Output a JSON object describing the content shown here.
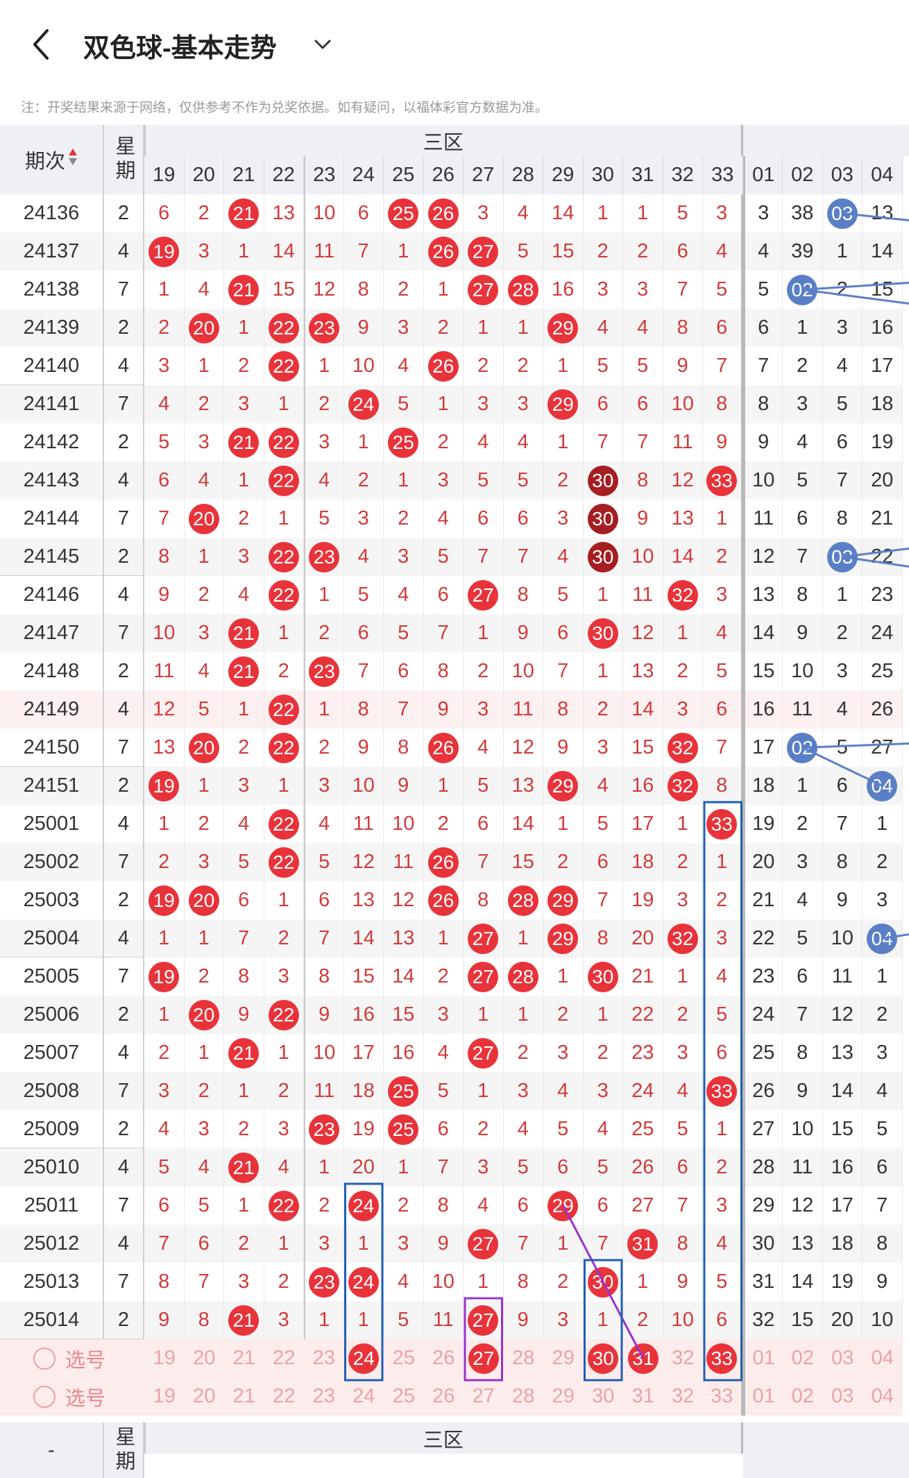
{
  "header": {
    "title": "双色球-基本走势",
    "back_icon": "chevron-left-icon",
    "dropdown_icon": "chevron-down-icon"
  },
  "notice": "注：开奖结果来源于网络，仅供参考不作为兑奖依据。如有疑问，以福体彩官方数据为准。",
  "table": {
    "col_period": "期次",
    "col_weekday": "星期",
    "zone_label": "三区",
    "red_columns": [
      "19",
      "20",
      "21",
      "22",
      "23",
      "24",
      "25",
      "26",
      "27",
      "28",
      "29",
      "30",
      "31",
      "32",
      "33"
    ],
    "blue_columns": [
      "01",
      "02",
      "03",
      "04"
    ],
    "rows": [
      {
        "period": "24136",
        "week": "2",
        "red": [
          "6",
          "2",
          "21",
          "13",
          "10",
          "6",
          "25",
          "26",
          "3",
          "4",
          "14",
          "1",
          "1",
          "5",
          "3"
        ],
        "hit": [
          21,
          25,
          26
        ],
        "blue": [
          "3",
          "38",
          "03",
          "13"
        ],
        "bhit": [
          3
        ]
      },
      {
        "period": "24137",
        "week": "4",
        "red": [
          "19",
          "3",
          "1",
          "14",
          "11",
          "7",
          "1",
          "26",
          "27",
          "5",
          "15",
          "2",
          "2",
          "6",
          "4"
        ],
        "hit": [
          19,
          26,
          27
        ],
        "blue": [
          "4",
          "39",
          "1",
          "14"
        ],
        "bhit": []
      },
      {
        "period": "24138",
        "week": "7",
        "red": [
          "1",
          "4",
          "21",
          "15",
          "12",
          "8",
          "2",
          "1",
          "27",
          "28",
          "16",
          "3",
          "3",
          "7",
          "5"
        ],
        "hit": [
          21,
          27,
          28
        ],
        "blue": [
          "5",
          "02",
          "2",
          "15"
        ],
        "bhit": [
          2
        ]
      },
      {
        "period": "24139",
        "week": "2",
        "red": [
          "2",
          "20",
          "1",
          "22",
          "23",
          "9",
          "3",
          "2",
          "1",
          "1",
          "29",
          "4",
          "4",
          "8",
          "6"
        ],
        "hit": [
          20,
          22,
          23,
          29
        ],
        "blue": [
          "6",
          "1",
          "3",
          "16"
        ],
        "bhit": []
      },
      {
        "period": "24140",
        "week": "4",
        "red": [
          "3",
          "1",
          "2",
          "22",
          "1",
          "10",
          "4",
          "26",
          "2",
          "2",
          "1",
          "5",
          "5",
          "9",
          "7"
        ],
        "hit": [
          22,
          26
        ],
        "blue": [
          "7",
          "2",
          "4",
          "17"
        ],
        "bhit": []
      },
      {
        "period": "24141",
        "week": "7",
        "red": [
          "4",
          "2",
          "3",
          "1",
          "2",
          "24",
          "5",
          "1",
          "3",
          "3",
          "29",
          "6",
          "6",
          "10",
          "8"
        ],
        "hit": [
          24,
          29
        ],
        "blue": [
          "8",
          "3",
          "5",
          "18"
        ],
        "bhit": []
      },
      {
        "period": "24142",
        "week": "2",
        "red": [
          "5",
          "3",
          "21",
          "22",
          "3",
          "1",
          "25",
          "2",
          "4",
          "4",
          "1",
          "7",
          "7",
          "11",
          "9"
        ],
        "hit": [
          21,
          22,
          25
        ],
        "blue": [
          "9",
          "4",
          "6",
          "19"
        ],
        "bhit": []
      },
      {
        "period": "24143",
        "week": "4",
        "red": [
          "6",
          "4",
          "1",
          "22",
          "4",
          "2",
          "1",
          "3",
          "5",
          "5",
          "2",
          "30",
          "8",
          "12",
          "33"
        ],
        "hit": [
          22,
          30,
          33
        ],
        "blue": [
          "10",
          "5",
          "7",
          "20"
        ],
        "bhit": []
      },
      {
        "period": "24144",
        "week": "7",
        "red": [
          "7",
          "20",
          "2",
          "1",
          "5",
          "3",
          "2",
          "4",
          "6",
          "6",
          "3",
          "30",
          "9",
          "13",
          "1"
        ],
        "hit": [
          20,
          30
        ],
        "blue": [
          "11",
          "6",
          "8",
          "21"
        ],
        "bhit": []
      },
      {
        "period": "24145",
        "week": "2",
        "red": [
          "8",
          "1",
          "3",
          "22",
          "23",
          "4",
          "3",
          "5",
          "7",
          "7",
          "4",
          "30",
          "10",
          "14",
          "2"
        ],
        "hit": [
          22,
          23,
          30
        ],
        "blue": [
          "12",
          "7",
          "03",
          "22"
        ],
        "bhit": [
          3
        ]
      },
      {
        "period": "24146",
        "week": "4",
        "red": [
          "9",
          "2",
          "4",
          "22",
          "1",
          "5",
          "4",
          "6",
          "27",
          "8",
          "5",
          "1",
          "11",
          "32",
          "3"
        ],
        "hit": [
          22,
          27,
          32
        ],
        "blue": [
          "13",
          "8",
          "1",
          "23"
        ],
        "bhit": []
      },
      {
        "period": "24147",
        "week": "7",
        "red": [
          "10",
          "3",
          "21",
          "1",
          "2",
          "6",
          "5",
          "7",
          "1",
          "9",
          "6",
          "30",
          "12",
          "1",
          "4"
        ],
        "hit": [
          21,
          30
        ],
        "blue": [
          "14",
          "9",
          "2",
          "24"
        ],
        "bhit": []
      },
      {
        "period": "24148",
        "week": "2",
        "red": [
          "11",
          "4",
          "21",
          "2",
          "23",
          "7",
          "6",
          "8",
          "2",
          "10",
          "7",
          "1",
          "13",
          "2",
          "5"
        ],
        "hit": [
          21,
          23
        ],
        "blue": [
          "15",
          "10",
          "3",
          "25"
        ],
        "bhit": []
      },
      {
        "period": "24149",
        "week": "4",
        "red": [
          "12",
          "5",
          "1",
          "22",
          "1",
          "8",
          "7",
          "9",
          "3",
          "11",
          "8",
          "2",
          "14",
          "3",
          "6"
        ],
        "hit": [
          22
        ],
        "blue": [
          "16",
          "11",
          "4",
          "26"
        ],
        "bhit": []
      },
      {
        "period": "24150",
        "week": "7",
        "red": [
          "13",
          "20",
          "2",
          "22",
          "2",
          "9",
          "8",
          "26",
          "4",
          "12",
          "9",
          "3",
          "15",
          "32",
          "7"
        ],
        "hit": [
          20,
          22,
          26,
          32
        ],
        "blue": [
          "17",
          "02",
          "5",
          "27"
        ],
        "bhit": [
          2
        ]
      },
      {
        "period": "24151",
        "week": "2",
        "red": [
          "19",
          "1",
          "3",
          "1",
          "3",
          "10",
          "9",
          "1",
          "5",
          "13",
          "29",
          "4",
          "16",
          "32",
          "8"
        ],
        "hit": [
          19,
          29,
          32
        ],
        "blue": [
          "18",
          "1",
          "6",
          "04"
        ],
        "bhit": [
          4
        ]
      },
      {
        "period": "25001",
        "week": "4",
        "red": [
          "1",
          "2",
          "4",
          "22",
          "4",
          "11",
          "10",
          "2",
          "6",
          "14",
          "1",
          "5",
          "17",
          "1",
          "33"
        ],
        "hit": [
          22,
          33
        ],
        "blue": [
          "19",
          "2",
          "7",
          "1"
        ],
        "bhit": []
      },
      {
        "period": "25002",
        "week": "7",
        "red": [
          "2",
          "3",
          "5",
          "22",
          "5",
          "12",
          "11",
          "26",
          "7",
          "15",
          "2",
          "6",
          "18",
          "2",
          "1"
        ],
        "hit": [
          22,
          26
        ],
        "blue": [
          "20",
          "3",
          "8",
          "2"
        ],
        "bhit": []
      },
      {
        "period": "25003",
        "week": "2",
        "red": [
          "19",
          "20",
          "6",
          "1",
          "6",
          "13",
          "12",
          "26",
          "8",
          "28",
          "29",
          "7",
          "19",
          "3",
          "2"
        ],
        "hit": [
          19,
          20,
          26,
          28,
          29
        ],
        "blue": [
          "21",
          "4",
          "9",
          "3"
        ],
        "bhit": []
      },
      {
        "period": "25004",
        "week": "4",
        "red": [
          "1",
          "1",
          "7",
          "2",
          "7",
          "14",
          "13",
          "1",
          "27",
          "1",
          "29",
          "8",
          "20",
          "32",
          "3"
        ],
        "hit": [
          27,
          29,
          32
        ],
        "blue": [
          "22",
          "5",
          "10",
          "04"
        ],
        "bhit": [
          4
        ]
      },
      {
        "period": "25005",
        "week": "7",
        "red": [
          "19",
          "2",
          "8",
          "3",
          "8",
          "15",
          "14",
          "2",
          "27",
          "28",
          "1",
          "30",
          "21",
          "1",
          "4"
        ],
        "hit": [
          19,
          27,
          28,
          30
        ],
        "blue": [
          "23",
          "6",
          "11",
          "1"
        ],
        "bhit": []
      },
      {
        "period": "25006",
        "week": "2",
        "red": [
          "1",
          "20",
          "9",
          "22",
          "9",
          "16",
          "15",
          "3",
          "1",
          "1",
          "2",
          "1",
          "22",
          "2",
          "5"
        ],
        "hit": [
          20,
          22
        ],
        "blue": [
          "24",
          "7",
          "12",
          "2"
        ],
        "bhit": []
      },
      {
        "period": "25007",
        "week": "4",
        "red": [
          "2",
          "1",
          "21",
          "1",
          "10",
          "17",
          "16",
          "4",
          "27",
          "2",
          "3",
          "2",
          "23",
          "3",
          "6"
        ],
        "hit": [
          21,
          27
        ],
        "blue": [
          "25",
          "8",
          "13",
          "3"
        ],
        "bhit": []
      },
      {
        "period": "25008",
        "week": "7",
        "red": [
          "3",
          "2",
          "1",
          "2",
          "11",
          "18",
          "25",
          "5",
          "1",
          "3",
          "4",
          "3",
          "24",
          "4",
          "33"
        ],
        "hit": [
          25,
          33
        ],
        "blue": [
          "26",
          "9",
          "14",
          "4"
        ],
        "bhit": []
      },
      {
        "period": "25009",
        "week": "2",
        "red": [
          "4",
          "3",
          "2",
          "3",
          "23",
          "19",
          "25",
          "6",
          "2",
          "4",
          "5",
          "4",
          "25",
          "5",
          "1"
        ],
        "hit": [
          23,
          25
        ],
        "blue": [
          "27",
          "10",
          "15",
          "5"
        ],
        "bhit": []
      },
      {
        "period": "25010",
        "week": "4",
        "red": [
          "5",
          "4",
          "21",
          "4",
          "1",
          "20",
          "1",
          "7",
          "3",
          "5",
          "6",
          "5",
          "26",
          "6",
          "2"
        ],
        "hit": [
          21
        ],
        "blue": [
          "28",
          "11",
          "16",
          "6"
        ],
        "bhit": []
      },
      {
        "period": "25011",
        "week": "7",
        "red": [
          "6",
          "5",
          "1",
          "22",
          "2",
          "24",
          "2",
          "8",
          "4",
          "6",
          "29",
          "6",
          "27",
          "7",
          "3"
        ],
        "hit": [
          22,
          24,
          29
        ],
        "blue": [
          "29",
          "12",
          "17",
          "7"
        ],
        "bhit": []
      },
      {
        "period": "25012",
        "week": "4",
        "red": [
          "7",
          "6",
          "2",
          "1",
          "3",
          "1",
          "3",
          "9",
          "27",
          "7",
          "1",
          "7",
          "31",
          "8",
          "4"
        ],
        "hit": [
          27,
          31
        ],
        "blue": [
          "30",
          "13",
          "18",
          "8"
        ],
        "bhit": []
      },
      {
        "period": "25013",
        "week": "7",
        "red": [
          "8",
          "7",
          "3",
          "2",
          "23",
          "24",
          "4",
          "10",
          "1",
          "8",
          "2",
          "30",
          "1",
          "9",
          "5"
        ],
        "hit": [
          23,
          24,
          30
        ],
        "blue": [
          "31",
          "14",
          "19",
          "9"
        ],
        "bhit": []
      },
      {
        "period": "25014",
        "week": "2",
        "red": [
          "9",
          "8",
          "21",
          "3",
          "1",
          "1",
          "5",
          "11",
          "27",
          "9",
          "3",
          "1",
          "2",
          "10",
          "6"
        ],
        "hit": [
          21,
          27
        ],
        "blue": [
          "32",
          "15",
          "20",
          "10"
        ],
        "bhit": []
      }
    ],
    "select_label": "选号",
    "select_rows": [
      {
        "picked": [
          24,
          27,
          30,
          31,
          33
        ]
      },
      {
        "picked": []
      }
    ]
  },
  "colors": {
    "red_ball": "#e8333a",
    "dark_red_ball": "#a51e22",
    "blue_ball": "#5b7fc7",
    "text_red": "#d23a3a",
    "box_blue": "#1f5fb5",
    "box_purple": "#9932cc",
    "grid": "#e3e3e3"
  }
}
